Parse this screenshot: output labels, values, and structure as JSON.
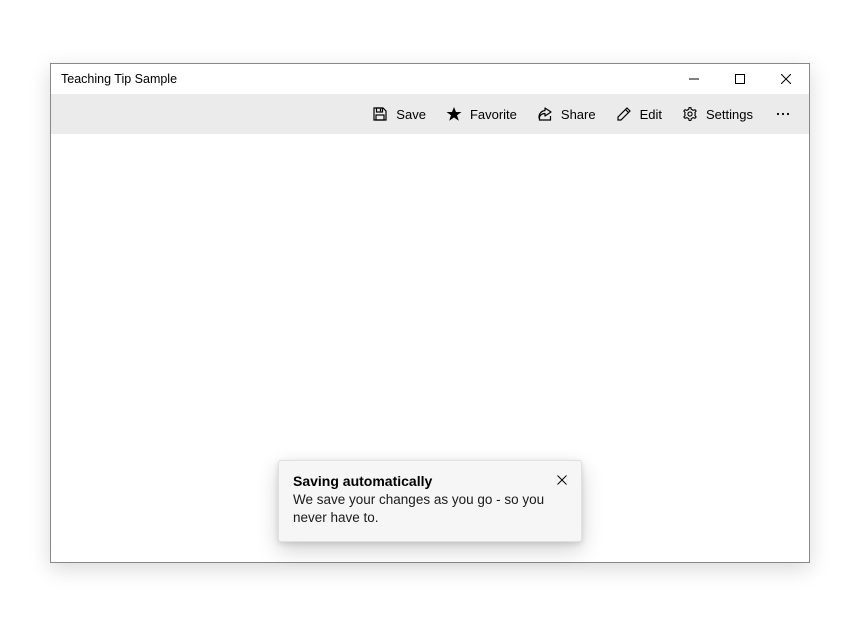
{
  "window": {
    "title": "Teaching Tip Sample"
  },
  "commandbar": {
    "save_label": "Save",
    "favorite_label": "Favorite",
    "share_label": "Share",
    "edit_label": "Edit",
    "settings_label": "Settings"
  },
  "teaching_tip": {
    "title": "Saving automatically",
    "subtitle": "We save your changes as you go - so you never have to."
  }
}
